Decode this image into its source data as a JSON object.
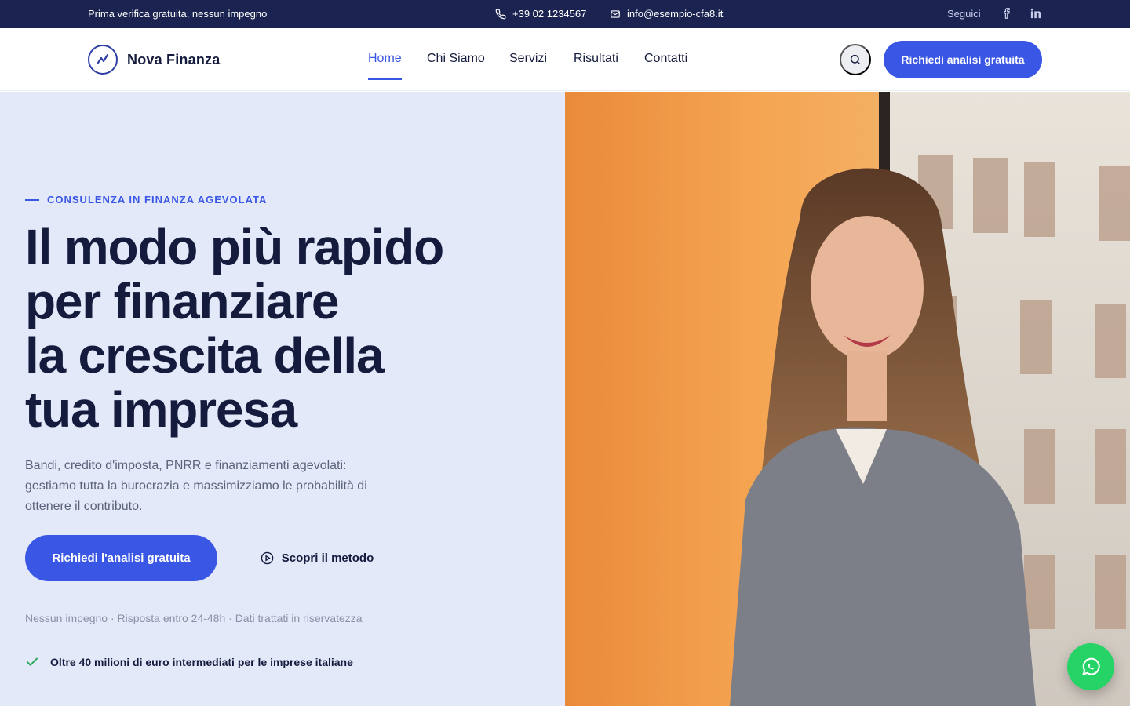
{
  "topbar": {
    "promo": "Prima verifica gratuita, nessun impegno",
    "phone": "+39 02 1234567",
    "email": "info@esempio-cfa8.it",
    "follow_label": "Seguici",
    "social": [
      {
        "icon": "facebook-icon"
      },
      {
        "icon": "linkedin-icon"
      }
    ]
  },
  "header": {
    "brand": "Nova Finanza",
    "nav": [
      {
        "label": "Home",
        "active": true
      },
      {
        "label": "Chi Siamo",
        "active": false
      },
      {
        "label": "Servizi",
        "active": false
      },
      {
        "label": "Risultati",
        "active": false
      },
      {
        "label": "Contatti",
        "active": false
      }
    ],
    "search_icon": "search-icon",
    "cta": "Richiedi analisi gratuita"
  },
  "hero": {
    "eyebrow": "CONSULENZA IN FINANZA AGEVOLATA",
    "headline": [
      "Il modo più rapido",
      "per finanziare",
      "la crescita della",
      "tua impresa"
    ],
    "subtext": "Bandi, credito d'imposta, PNRR e finanziamenti agevolati: gestiamo tutta la burocrazia e massimizziamo le probabilità di ottenere il contributo.",
    "primary_cta": "Richiedi l'analisi gratuita",
    "secondary_cta": "Scopri il metodo",
    "note": "Nessun impegno · Risposta entro 24-48h · Dati trattati in riservatezza",
    "proof": "Oltre 40 milioni di euro intermediati per le imprese italiane"
  },
  "colors": {
    "accent": "#3a56e4",
    "navy": "#1b2350",
    "hero_bg": "#e4e9fa",
    "whatsapp": "#25d366"
  }
}
